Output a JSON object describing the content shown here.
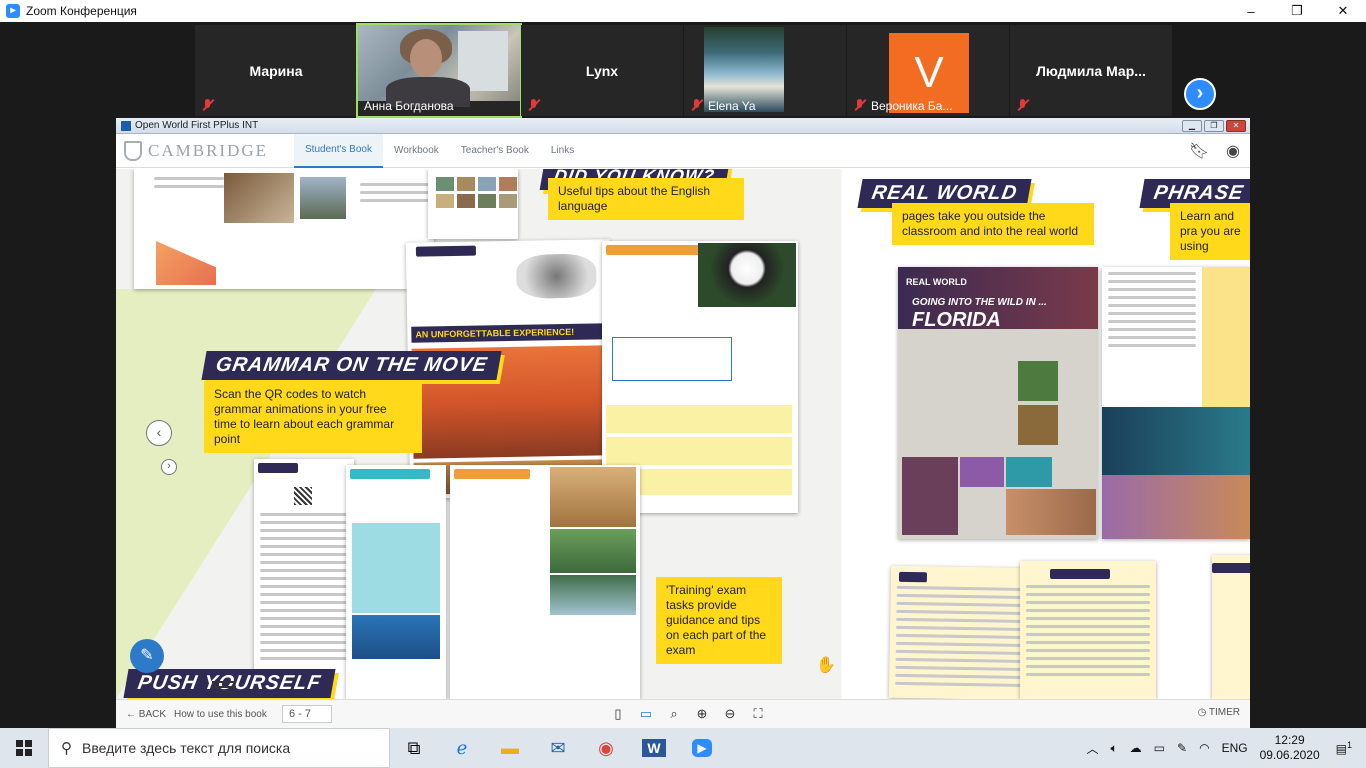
{
  "zoom": {
    "title": "Zoom Конференция",
    "window_controls": [
      "–",
      "❐",
      "✕"
    ]
  },
  "participants": [
    {
      "name": "Марина",
      "type": "name-tile"
    },
    {
      "name": "Анна Богданова",
      "type": "video"
    },
    {
      "name": "Lynx",
      "type": "name-tile"
    },
    {
      "name": "Elena Ya",
      "type": "video"
    },
    {
      "name": "Вероника Ба...",
      "type": "avatar",
      "initial": "V",
      "color": "#f26d21"
    },
    {
      "name": "Людмила Мар...",
      "type": "name-tile"
    }
  ],
  "next_arrow": "›",
  "app": {
    "title": "Open World First PPlus INT",
    "logo": "CAMBRIDGE",
    "tabs": [
      "Student's Book",
      "Workbook",
      "Teacher's Book",
      "Links"
    ],
    "active_tab": "Student's Book"
  },
  "book": {
    "left_callouts": {
      "did_you_know_tip": "Useful tips about the English language",
      "grammar_banner": "GRAMMAR ON THE MOVE",
      "grammar_text": "Scan the QR codes to watch grammar animations in your free time to learn about each grammar point",
      "training_text": "'Training' exam tasks provide guidance and tips on each part of the exam",
      "push_banner": "PUSH YOURSELF",
      "unforgettable": "AN UNFORGETTABLE EXPERIENCE!"
    },
    "right_callouts": {
      "real_world_banner": "REAL WORLD",
      "real_world_text": "pages take you outside the classroom and into the real world",
      "phrase_banner": "PHRASE",
      "phrase_text": "Learn and pra you are using",
      "florida_kicker": "GOING INTO THE WILD IN ...",
      "florida_title": "FLORIDA",
      "real_world_tag": "REAL WORLD"
    }
  },
  "toolbar": {
    "back": "BACK",
    "how_to": "How to use this book",
    "page": "6 - 7",
    "timer": "TIMER"
  },
  "taskbar": {
    "search_placeholder": "Введите здесь текст для поиска",
    "lang": "ENG",
    "time": "12:29",
    "date": "09.06.2020",
    "notifications": "1"
  },
  "colors": {
    "zoom_blue": "#2d8cff",
    "banner_navy": "#2e2a55",
    "callout_yellow": "#ffd91a",
    "tab_active": "#2c7ac8"
  }
}
